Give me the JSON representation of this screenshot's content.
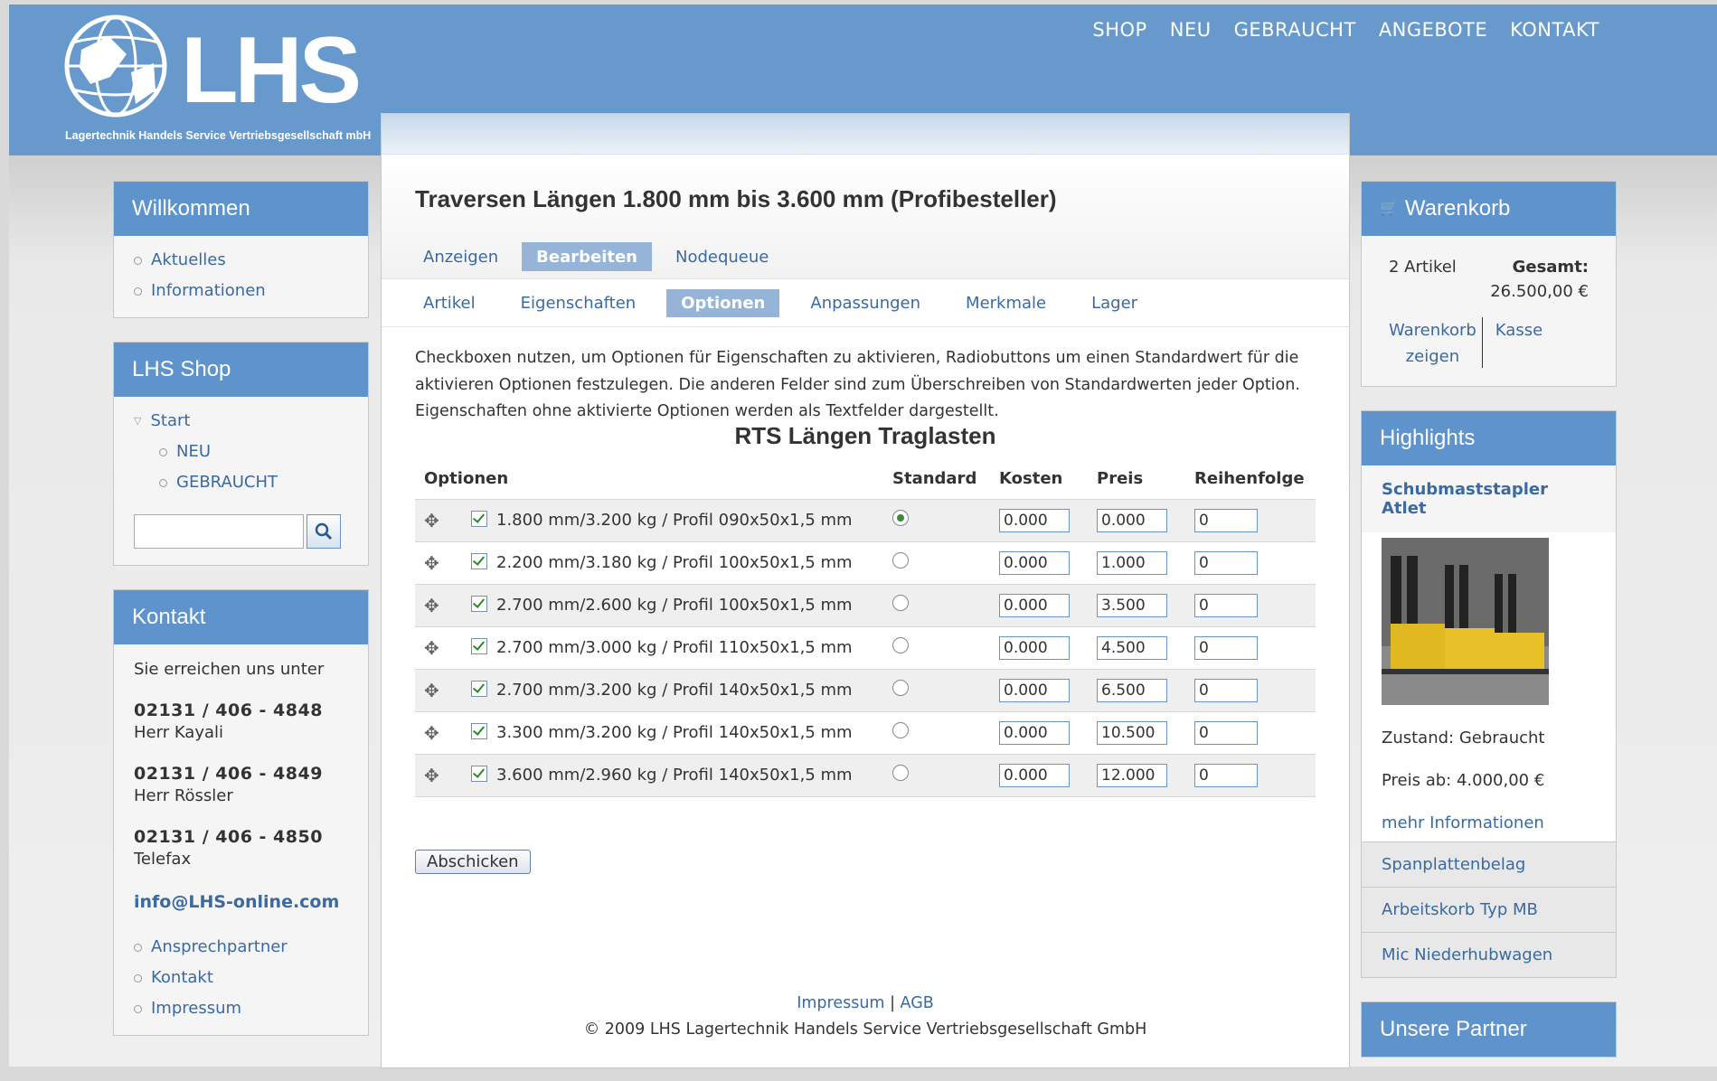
{
  "brand": {
    "logo_text": "LHS",
    "logo_subtitle": "Lagertechnik Handels Service Vertriebsgesellschaft mbH"
  },
  "topnav": [
    "SHOP",
    "NEU",
    "GEBRAUCHT",
    "ANGEBOTE",
    "KONTAKT"
  ],
  "sidebar_left": {
    "welcome": {
      "title": "Willkommen",
      "items": [
        "Aktuelles",
        "Informationen"
      ]
    },
    "shop": {
      "title": "LHS Shop",
      "start": "Start",
      "sub_items": [
        "NEU",
        "GEBRAUCHT"
      ],
      "search_value": ""
    },
    "contact": {
      "title": "Kontakt",
      "intro": "Sie erreichen uns unter",
      "phones": [
        {
          "number": "02131 / 406 - 4848",
          "name": "Herr Kayali"
        },
        {
          "number": "02131 / 406 - 4849",
          "name": "Herr Rössler"
        },
        {
          "number": "02131 / 406 - 4850",
          "name": "Telefax"
        }
      ],
      "email": "info@LHS-online.com",
      "links": [
        "Ansprechpartner",
        "Kontakt",
        "Impressum"
      ]
    }
  },
  "main": {
    "title": "Traversen Längen 1.800 mm bis 3.600 mm (Profibesteller)",
    "tabs": [
      {
        "label": "Anzeigen",
        "active": false
      },
      {
        "label": "Bearbeiten",
        "active": true
      },
      {
        "label": "Nodequeue",
        "active": false
      }
    ],
    "subtabs": [
      {
        "label": "Artikel",
        "active": false
      },
      {
        "label": "Eigenschaften",
        "active": false
      },
      {
        "label": "Optionen",
        "active": true
      },
      {
        "label": "Anpassungen",
        "active": false
      },
      {
        "label": "Merkmale",
        "active": false
      },
      {
        "label": "Lager",
        "active": false
      }
    ],
    "description": "Checkboxen nutzen, um Optionen für Eigenschaften zu aktivieren, Radiobuttons um einen Standardwert für die aktivieren Optionen festzulegen. Die anderen Felder sind zum Überschreiben von Standardwerten jeder Option. Eigenschaften ohne aktivierte Optionen werden als Textfelder dargestellt.",
    "table_title": "RTS Längen Traglasten",
    "columns": [
      "Optionen",
      "Standard",
      "Kosten",
      "Preis",
      "Reihenfolge"
    ],
    "rows": [
      {
        "label": "1.800 mm/3.200 kg / Profil 090x50x1,5 mm",
        "enabled": true,
        "default": true,
        "kosten": "0.000",
        "preis": "0.000",
        "order": "0"
      },
      {
        "label": "2.200 mm/3.180 kg / Profil 100x50x1,5 mm",
        "enabled": true,
        "default": false,
        "kosten": "0.000",
        "preis": "1.000",
        "order": "0"
      },
      {
        "label": "2.700 mm/2.600 kg / Profil 100x50x1,5 mm",
        "enabled": true,
        "default": false,
        "kosten": "0.000",
        "preis": "3.500",
        "order": "0"
      },
      {
        "label": "2.700 mm/3.000 kg / Profil 110x50x1,5 mm",
        "enabled": true,
        "default": false,
        "kosten": "0.000",
        "preis": "4.500",
        "order": "0"
      },
      {
        "label": "2.700 mm/3.200 kg / Profil 140x50x1,5 mm",
        "enabled": true,
        "default": false,
        "kosten": "0.000",
        "preis": "6.500",
        "order": "0"
      },
      {
        "label": "3.300 mm/3.200 kg / Profil 140x50x1,5 mm",
        "enabled": true,
        "default": false,
        "kosten": "0.000",
        "preis": "10.500",
        "order": "0"
      },
      {
        "label": "3.600 mm/2.960 kg / Profil 140x50x1,5 mm",
        "enabled": true,
        "default": false,
        "kosten": "0.000",
        "preis": "12.000",
        "order": "0"
      }
    ],
    "submit_label": "Abschicken",
    "footer": {
      "impressum": "Impressum",
      "separator": "|",
      "agb": "AGB",
      "copyright": "© 2009 LHS Lagertechnik Handels Service Vertriebsgesellschaft GmbH"
    }
  },
  "sidebar_right": {
    "cart": {
      "title": "Warenkorb",
      "count": "2 Artikel",
      "total_label": "Gesamt:",
      "total_value": "26.500,00 €",
      "show_line1": "Warenkorb",
      "show_line2": "zeigen",
      "checkout": "Kasse"
    },
    "highlights": {
      "title": "Highlights",
      "item_title": "Schubmaststapler Atlet",
      "condition": "Zustand: Gebraucht",
      "price": "Preis ab: 4.000,00 €",
      "more": "mehr Informationen",
      "other_items": [
        "Spanplattenbelag",
        "Arbeitskorb Typ MB",
        "Mic Niederhubwagen"
      ]
    },
    "partners": {
      "title": "Unsere Partner"
    }
  },
  "colors": {
    "header_blue": "#6799cc",
    "box_head_blue": "#5f93cc",
    "link_blue": "#3a6aa0",
    "active_tab": "#95b4d8"
  }
}
